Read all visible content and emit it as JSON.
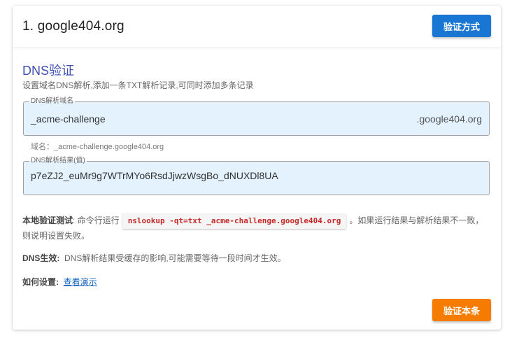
{
  "header": {
    "title": "1. google404.org",
    "method_button": "验证方式"
  },
  "section": {
    "title": "DNS验证",
    "description": "设置域名DNS解析,添加一条TXT解析记录,可同时添加多条记录"
  },
  "dns_name_field": {
    "label": "DNS解析域名",
    "value": "_acme-challenge",
    "suffix": ".google404.org",
    "hint": "域名：_acme-challenge.google404.org"
  },
  "dns_value_field": {
    "label": "DNS解析结果(值)",
    "value": "p7eZJ2_euMr9g7WTrMYo6RsdJjwzWsgBo_dNUXDl8UA"
  },
  "local_test": {
    "label": "本地验证测试",
    "prefix": ": 命令行运行",
    "command": "nslookup -qt=txt _acme-challenge.google404.org",
    "suffix": "。如果运行结果与解析结果不一致，则说明设置失败。"
  },
  "dns_effect": {
    "label": "DNS生效:",
    "text": "DNS解析结果受缓存的影响,可能需要等待一段时间才生效。"
  },
  "how_to": {
    "label": "如何设置:",
    "link": "查看演示"
  },
  "footer": {
    "verify_button": "验证本条"
  },
  "colors": {
    "title_accent": "#3f51b5",
    "method_button": "#1976d2",
    "verify_button": "#f57c00",
    "field_background": "#e3f2fd",
    "command_text": "#c62828"
  }
}
